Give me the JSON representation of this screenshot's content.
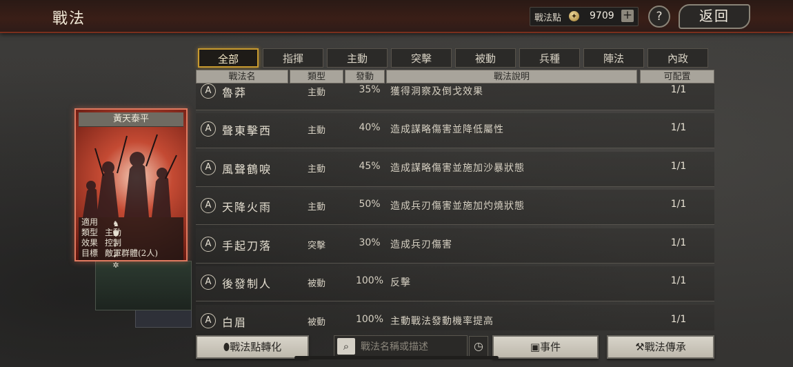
{
  "header": {
    "title": "戰法",
    "points_label": "戰法點",
    "points_value": "9709",
    "plus_label": "+",
    "help_label": "?",
    "back_label": "返回"
  },
  "tabs": [
    "全部",
    "指揮",
    "主動",
    "突擊",
    "被動",
    "兵種",
    "陣法",
    "內政"
  ],
  "active_tab": "全部",
  "columns": {
    "name": "戰法名",
    "type": "類型",
    "rate": "發動",
    "desc": "戰法說明",
    "config": "可配置"
  },
  "rows": [
    {
      "grade": "A",
      "name": "魯莽",
      "type": "主動",
      "rate": "35%",
      "desc": "獲得洞察及倒戈效果",
      "config": "1/1"
    },
    {
      "grade": "A",
      "name": "聲東擊西",
      "type": "主動",
      "rate": "40%",
      "desc": "造成謀略傷害並降低屬性",
      "config": "1/1"
    },
    {
      "grade": "A",
      "name": "風聲鶴唳",
      "type": "主動",
      "rate": "45%",
      "desc": "造成謀略傷害並施加沙暴狀態",
      "config": "1/1"
    },
    {
      "grade": "A",
      "name": "天降火雨",
      "type": "主動",
      "rate": "50%",
      "desc": "造成兵刃傷害並施加灼燒狀態",
      "config": "1/1"
    },
    {
      "grade": "A",
      "name": "手起刀落",
      "type": "突擊",
      "rate": "30%",
      "desc": "造成兵刃傷害",
      "config": "1/1"
    },
    {
      "grade": "A",
      "name": "後發制人",
      "type": "被動",
      "rate": "100%",
      "desc": "反擊",
      "config": "1/1"
    },
    {
      "grade": "A",
      "name": "白眉",
      "type": "被動",
      "rate": "100%",
      "desc": "主動戰法發動機率提高",
      "config": "1/1"
    }
  ],
  "card": {
    "title": "黃天泰平",
    "applies_label": "適用",
    "type_label": "類型",
    "type_value": "主動",
    "effect_label": "效果",
    "effect_value": "控制",
    "target_label": "目標",
    "target_value": "敵軍群體(2人)",
    "unit_icons": [
      "cavalry-icon",
      "shield-icon",
      "bow-icon",
      "spear-icon",
      "wheel-icon"
    ]
  },
  "bottom": {
    "convert_label": "戰法點轉化",
    "search_placeholder": "戰法名稱或描述",
    "events_label": "事件",
    "inherit_label": "戰法傳承"
  }
}
